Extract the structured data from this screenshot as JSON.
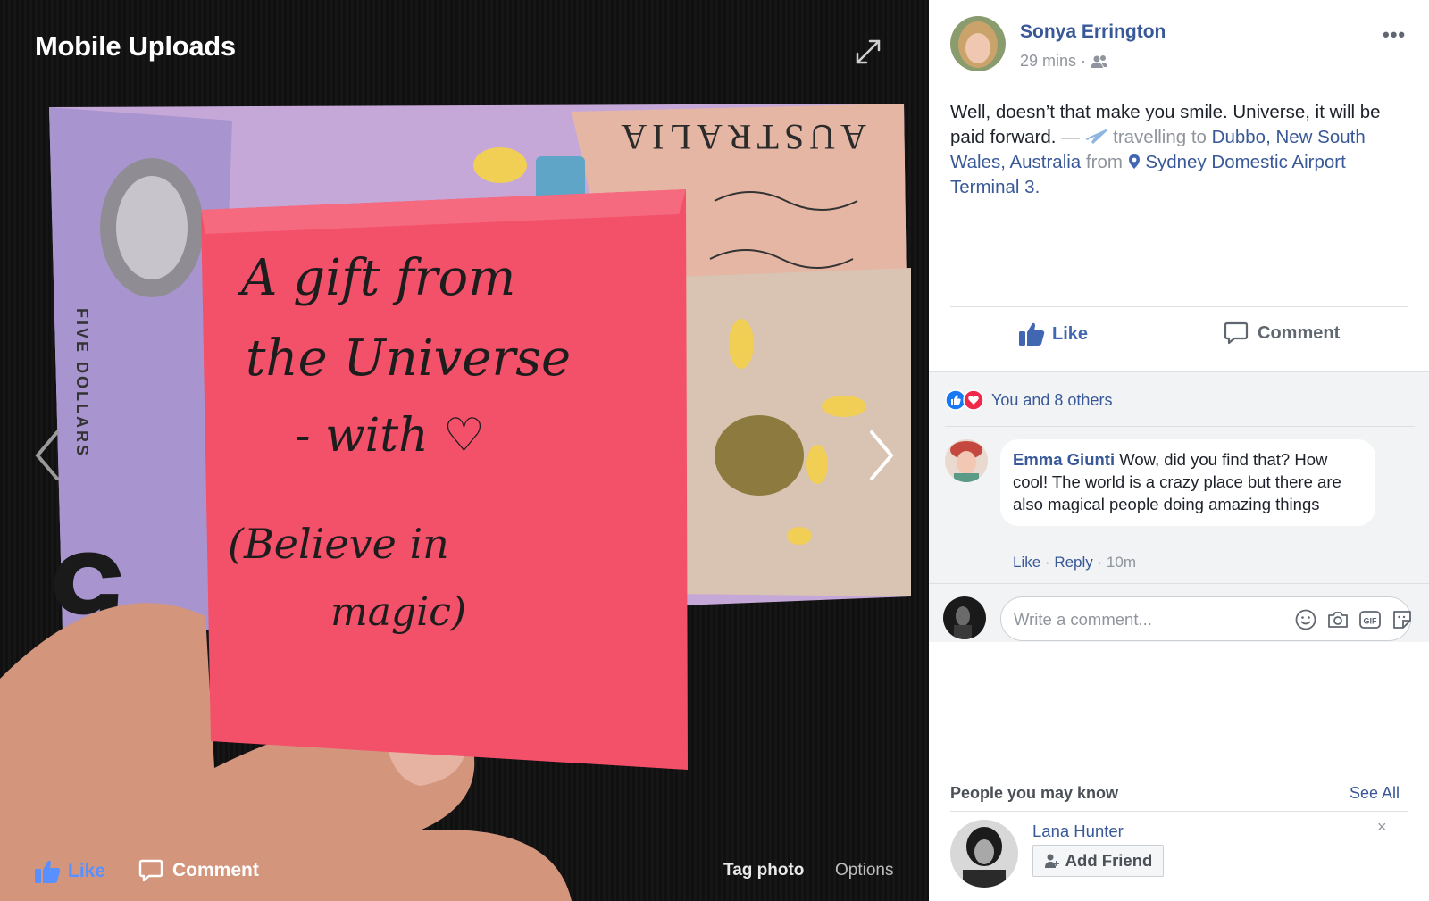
{
  "viewer": {
    "title": "Mobile Uploads",
    "photo_note_lines": [
      "A gift from",
      "the Universe",
      "- with ♡",
      "(Believe in",
      "magic)"
    ],
    "banknote_text": "AUSTRALIA",
    "banknote_denomination": "5",
    "banknote_side_text": "FIVE DOLLARS",
    "toolbar": {
      "like_label": "Like",
      "comment_label": "Comment",
      "tag_label": "Tag photo",
      "options_label": "Options"
    }
  },
  "post": {
    "author": "Sonya Errington",
    "time": "29 mins",
    "text_plain": "Well, doesn’t that make you smile. Universe, it will be paid forward.",
    "activity_prefix": " — ",
    "activity_label": "travelling to",
    "destination": "Dubbo, New South Wales, Australia",
    "from_word": "from",
    "origin": "Sydney Domestic Airport Terminal 3",
    "period": ".",
    "like_label": "Like",
    "comment_label": "Comment"
  },
  "reactions": {
    "text": "You and 8 others"
  },
  "comments": [
    {
      "author": "Emma Giunti",
      "text": "Wow, did you find that? How cool! The world is a crazy place but there are also magical people doing amazing things",
      "like": "Like",
      "reply": "Reply",
      "time": "10m"
    }
  ],
  "composer": {
    "placeholder": "Write a comment..."
  },
  "pymk": {
    "title": "People you may know",
    "see_all": "See All",
    "person": "Lana Hunter",
    "add_friend": "Add Friend",
    "close": "×"
  },
  "colors": {
    "fb_blue": "#385898",
    "like_blue": "#4267b2",
    "viewer_like": "#5890ff",
    "note_pink": "#f3506a",
    "heart_red": "#f0284a"
  }
}
